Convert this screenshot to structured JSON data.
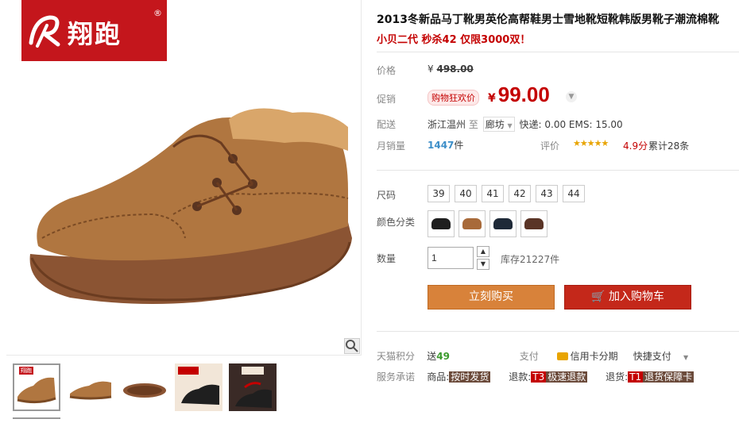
{
  "brand": {
    "logo_text": "翔跑",
    "logo_reg": "®"
  },
  "product": {
    "title": "2013冬新品马丁靴男英伦高帮鞋男士雪地靴短靴韩版男靴子潮流棉靴",
    "subtitle": "小贝二代 秒杀42 仅限3000双！"
  },
  "price": {
    "label": "价格",
    "currency": "¥",
    "original": "498.00"
  },
  "promo": {
    "label": "促销",
    "tag": "购物狂欢价",
    "currency": "¥",
    "price": "99.00",
    "dropdown_icon": "chevron-down-icon"
  },
  "shipping": {
    "label": "配送",
    "from": "浙江温州",
    "to_word": "至",
    "dest": "廊坊",
    "dest_icon": "caret-down-icon",
    "fee": "快递: 0.00 EMS: 15.00"
  },
  "sales": {
    "label": "月销量",
    "count": "1447",
    "unit": "件",
    "rating_label": "评价",
    "stars": "★★★★★",
    "score": "4.9分",
    "total": "累计28条"
  },
  "size": {
    "label": "尺码",
    "options": [
      "39",
      "40",
      "41",
      "42",
      "43",
      "44"
    ]
  },
  "colors": {
    "label": "颜色分类",
    "swatches": [
      "#1f1f1f",
      "#a86a3a",
      "#1f2a38",
      "#5a3426"
    ]
  },
  "quantity": {
    "label": "数量",
    "value": "1",
    "stock": "库存21227件"
  },
  "buttons": {
    "buy": "立刻购买",
    "cart": "加入购物车",
    "cart_icon": "cart-icon"
  },
  "points": {
    "label": "天猫积分",
    "prefix": "送",
    "value": "49",
    "pay_label": "支付",
    "credit": "信用卡分期",
    "quick_pay": "快捷支付"
  },
  "service": {
    "label": "服务承诺",
    "goods": "商品:",
    "goods_tag": "按时发货",
    "refund": "退款:",
    "refund_code": "T3",
    "refund_tag": "极速退款",
    "return": "退货:",
    "return_code": "T1",
    "return_tag": "退货保障卡"
  },
  "thumbs": {
    "mini_logo": "翔跑"
  },
  "colors_ui": {
    "accent": "#c40000",
    "brand": "#c4161c",
    "buy": "#d8823a",
    "cart": "#c4281a"
  }
}
